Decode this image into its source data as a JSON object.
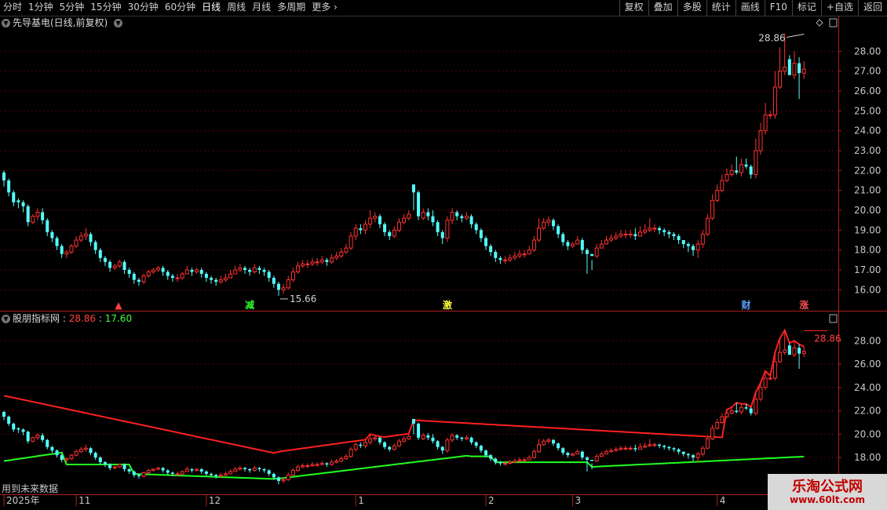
{
  "toolbar": {
    "periods": [
      "分时",
      "1分钟",
      "5分钟",
      "15分钟",
      "30分钟",
      "60分钟",
      "日线",
      "周线",
      "月线",
      "多周期",
      "更多"
    ],
    "active_period": "日线",
    "buttons": [
      "复权",
      "叠加",
      "多股",
      "统计",
      "画线",
      "F10",
      "标记",
      "+自选",
      "返回"
    ]
  },
  "main_header": {
    "title": "先导基电(日线,前复权)"
  },
  "indicator_header": {
    "name": "股朋指标网",
    "value_red": "28.86",
    "value_green": "17.60"
  },
  "colors": {
    "up": "#ff3232",
    "down": "#54ffff",
    "upper_band": "#ff2020",
    "lower_band": "#20ff20",
    "grid": "#5a0000"
  },
  "chart_data": {
    "type": "candlestick",
    "main_axis": {
      "ticks": [
        "16.00",
        "17.00",
        "18.00",
        "19.00",
        "20.00",
        "21.00",
        "22.00",
        "23.00",
        "24.00",
        "25.00",
        "26.00",
        "27.00",
        "28.00"
      ],
      "ylim": [
        15.5,
        29.0
      ]
    },
    "indicator_axis": {
      "ticks": [
        "18.00",
        "20.00",
        "22.00",
        "24.00",
        "26.00",
        "28.00"
      ],
      "ylim": [
        17.0,
        29.5
      ]
    },
    "x_labels": [
      "2025年",
      "11",
      "12",
      "1",
      "2",
      "3",
      "4"
    ],
    "x_label_index": [
      0,
      15,
      42,
      73,
      100,
      118,
      148
    ],
    "max_label": "28.86",
    "max_index": 166,
    "min_label": "15.66",
    "min_index": 57,
    "main_markers": [
      {
        "index": 24,
        "text": "▲",
        "color": "#ff4040"
      },
      {
        "index": 51,
        "text": "减",
        "color": "#30ff30"
      },
      {
        "index": 92,
        "text": "激",
        "color": "#ffff40"
      },
      {
        "index": 154,
        "text": "财",
        "color": "#5aa0ff"
      },
      {
        "index": 166,
        "text": "涨",
        "color": "#ff5050"
      }
    ],
    "indicator_label": "28.86",
    "future_note": "用到未来数据",
    "close": [
      21.5,
      20.9,
      20.4,
      20.4,
      20.2,
      19.4,
      19.7,
      19.9,
      19.5,
      18.9,
      18.6,
      18.2,
      17.8,
      17.9,
      18.2,
      18.5,
      18.7,
      18.8,
      18.4,
      18.0,
      17.6,
      17.4,
      17.1,
      17.2,
      17.4,
      17.0,
      16.8,
      16.5,
      16.4,
      16.7,
      16.9,
      17.0,
      17.1,
      16.9,
      16.7,
      16.6,
      16.6,
      16.8,
      17.0,
      16.9,
      17.0,
      16.8,
      16.6,
      16.5,
      16.4,
      16.5,
      16.6,
      16.8,
      17.0,
      17.1,
      17.0,
      16.9,
      17.1,
      17.0,
      16.9,
      16.6,
      16.3,
      16.0,
      16.1,
      16.5,
      16.9,
      17.2,
      17.3,
      17.3,
      17.4,
      17.4,
      17.5,
      17.4,
      17.6,
      17.7,
      17.9,
      18.1,
      18.7,
      19.1,
      19.0,
      19.3,
      19.6,
      19.7,
      19.3,
      18.9,
      18.7,
      19.0,
      19.4,
      19.6,
      19.8,
      20.9,
      19.7,
      19.9,
      19.7,
      19.4,
      18.9,
      18.6,
      19.5,
      19.9,
      19.7,
      19.6,
      19.7,
      19.3,
      19.0,
      18.6,
      18.2,
      17.9,
      17.6,
      17.5,
      17.5,
      17.6,
      17.7,
      17.8,
      17.8,
      18.0,
      18.5,
      19.1,
      19.4,
      19.5,
      19.2,
      18.8,
      18.4,
      18.2,
      18.3,
      18.5,
      18.0,
      17.8,
      17.7,
      18.1,
      18.3,
      18.5,
      18.6,
      18.7,
      18.8,
      18.8,
      18.8,
      18.7,
      18.9,
      19.0,
      19.1,
      19.1,
      19.0,
      18.9,
      18.8,
      18.7,
      18.5,
      18.3,
      18.2,
      18.0,
      18.3,
      18.8,
      19.6,
      20.5,
      21.0,
      21.5,
      21.8,
      22.0,
      21.9,
      22.3,
      22.2,
      21.8,
      23.0,
      24.0,
      24.8,
      24.8,
      26.2,
      27.0,
      27.2,
      26.8,
      27.4,
      26.9,
      27.1
    ],
    "open": [
      21.9,
      21.5,
      20.9,
      20.5,
      20.4,
      20.2,
      19.4,
      19.7,
      19.9,
      19.5,
      18.9,
      18.6,
      18.2,
      17.8,
      17.9,
      18.2,
      18.5,
      18.7,
      18.8,
      18.4,
      18.0,
      17.6,
      17.4,
      17.1,
      17.2,
      17.4,
      17.0,
      16.8,
      16.5,
      16.4,
      16.7,
      16.9,
      17.0,
      17.1,
      16.9,
      16.7,
      16.6,
      16.6,
      16.8,
      17.0,
      16.9,
      17.0,
      16.8,
      16.6,
      16.5,
      16.4,
      16.5,
      16.6,
      16.8,
      17.0,
      17.1,
      17.0,
      16.9,
      17.1,
      17.0,
      16.9,
      16.6,
      16.3,
      16.0,
      16.1,
      16.5,
      16.9,
      17.2,
      17.3,
      17.3,
      17.4,
      17.4,
      17.5,
      17.4,
      17.6,
      17.7,
      17.9,
      18.1,
      18.7,
      19.1,
      19.0,
      19.3,
      19.6,
      19.7,
      19.3,
      18.9,
      18.7,
      19.0,
      19.4,
      19.6,
      21.3,
      20.9,
      19.6,
      19.9,
      19.7,
      19.4,
      18.9,
      18.6,
      19.5,
      19.9,
      19.7,
      19.6,
      19.7,
      19.3,
      19.0,
      18.6,
      18.2,
      17.9,
      17.6,
      17.5,
      17.5,
      17.6,
      17.7,
      17.8,
      17.8,
      18.0,
      18.5,
      19.1,
      19.4,
      19.5,
      19.2,
      18.8,
      18.4,
      18.2,
      18.3,
      18.5,
      18.0,
      17.8,
      17.7,
      18.1,
      18.3,
      18.5,
      18.6,
      18.7,
      18.8,
      18.8,
      18.8,
      18.7,
      18.9,
      19.0,
      19.1,
      19.1,
      19.0,
      18.9,
      18.8,
      18.7,
      18.5,
      18.3,
      18.2,
      18.0,
      18.3,
      18.8,
      19.6,
      20.5,
      21.0,
      21.5,
      21.8,
      22.0,
      21.9,
      22.3,
      22.2,
      21.8,
      23.0,
      24.0,
      24.8,
      24.8,
      26.2,
      27.0,
      27.6,
      26.8,
      27.4,
      26.9
    ],
    "high": [
      22.0,
      21.6,
      21.0,
      20.6,
      20.5,
      20.3,
      19.8,
      20.1,
      20.1,
      19.6,
      19.0,
      18.7,
      18.3,
      18.0,
      18.3,
      18.7,
      18.9,
      19.1,
      18.9,
      18.5,
      18.1,
      17.7,
      17.5,
      17.3,
      17.5,
      17.5,
      17.1,
      16.9,
      16.6,
      16.8,
      17.0,
      17.1,
      17.2,
      17.2,
      17.0,
      16.8,
      16.8,
      16.9,
      17.2,
      17.1,
      17.1,
      17.1,
      16.9,
      16.7,
      16.6,
      16.7,
      16.8,
      17.0,
      17.2,
      17.3,
      17.2,
      17.1,
      17.3,
      17.2,
      17.1,
      17.0,
      16.7,
      16.4,
      16.3,
      16.7,
      17.1,
      17.4,
      17.5,
      17.5,
      17.6,
      17.6,
      17.7,
      17.6,
      17.8,
      17.9,
      18.1,
      18.3,
      18.9,
      19.3,
      19.3,
      19.5,
      20.0,
      19.9,
      19.8,
      19.4,
      19.0,
      19.2,
      19.6,
      19.8,
      20.0,
      21.3,
      21.0,
      20.1,
      20.1,
      20.0,
      19.5,
      19.0,
      19.7,
      20.1,
      20.0,
      19.8,
      19.9,
      19.8,
      19.4,
      19.1,
      18.7,
      18.3,
      18.0,
      17.7,
      17.7,
      17.8,
      17.9,
      18.0,
      18.0,
      18.2,
      18.7,
      19.6,
      19.6,
      19.7,
      19.6,
      19.3,
      18.9,
      18.5,
      18.4,
      18.7,
      18.6,
      18.1,
      17.0,
      18.3,
      18.5,
      18.7,
      18.8,
      18.9,
      19.0,
      19.0,
      19.0,
      19.1,
      19.2,
      19.3,
      19.6,
      19.3,
      19.2,
      19.1,
      19.0,
      18.9,
      18.8,
      18.5,
      18.4,
      18.3,
      18.5,
      19.0,
      19.8,
      20.8,
      21.3,
      21.8,
      22.1,
      22.3,
      22.7,
      22.6,
      22.6,
      22.3,
      23.6,
      24.4,
      25.4,
      25.0,
      27.0,
      28.2,
      28.9,
      27.8,
      28.0,
      27.7,
      27.5
    ],
    "low": [
      21.2,
      20.7,
      20.2,
      20.1,
      19.9,
      19.2,
      19.3,
      19.5,
      19.3,
      18.7,
      18.4,
      18.0,
      17.6,
      17.6,
      17.8,
      18.1,
      18.4,
      18.5,
      18.2,
      17.8,
      17.4,
      17.2,
      16.9,
      17.0,
      17.1,
      16.8,
      16.6,
      16.3,
      16.2,
      16.3,
      16.6,
      16.8,
      16.9,
      16.7,
      16.5,
      16.4,
      16.4,
      16.5,
      16.8,
      16.7,
      16.8,
      16.6,
      16.4,
      16.3,
      16.2,
      16.3,
      16.4,
      16.6,
      16.8,
      16.9,
      16.8,
      16.7,
      16.8,
      16.8,
      16.7,
      16.4,
      16.1,
      15.7,
      15.8,
      16.0,
      16.4,
      16.8,
      17.1,
      17.1,
      17.2,
      17.2,
      17.3,
      17.2,
      17.3,
      17.5,
      17.6,
      17.8,
      18.0,
      18.5,
      18.8,
      18.8,
      19.1,
      19.4,
      19.1,
      18.7,
      18.5,
      18.6,
      18.9,
      19.3,
      19.5,
      20.0,
      19.5,
      19.5,
      19.5,
      19.2,
      18.7,
      18.3,
      18.4,
      19.3,
      19.5,
      19.4,
      19.5,
      19.1,
      18.8,
      18.4,
      18.0,
      17.7,
      17.4,
      17.3,
      17.3,
      17.4,
      17.5,
      17.6,
      17.6,
      17.8,
      17.9,
      18.4,
      19.0,
      19.2,
      19.0,
      18.6,
      18.2,
      18.0,
      18.1,
      18.3,
      17.8,
      16.8,
      17.5,
      17.6,
      18.1,
      18.3,
      18.4,
      18.5,
      18.6,
      18.6,
      18.6,
      18.5,
      18.7,
      18.8,
      18.9,
      18.9,
      18.8,
      18.7,
      18.6,
      18.5,
      18.3,
      18.1,
      17.9,
      17.7,
      17.6,
      18.1,
      18.7,
      19.5,
      20.4,
      20.9,
      21.4,
      21.7,
      21.8,
      21.7,
      22.1,
      21.6,
      21.6,
      22.8,
      23.8,
      24.6,
      24.6,
      26.1,
      26.8,
      26.9,
      26.6,
      25.6,
      26.6
    ]
  }
}
